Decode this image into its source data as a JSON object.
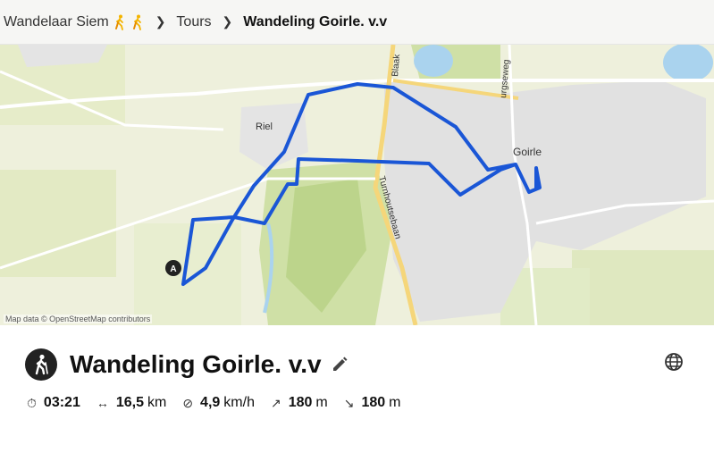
{
  "breadcrumb": {
    "user": "Wandelaar Siem",
    "section": "Tours",
    "current": "Wandeling Goirle. v.v"
  },
  "map": {
    "labels": {
      "riel": "Riel",
      "goirle": "Goirle",
      "blaak": "Blaak",
      "burgseweg": "urgseweg",
      "turnhoutsebaan": "Turnhoutsebaan"
    },
    "start_marker": "A",
    "attribution": "Map data © OpenStreetMap contributors",
    "route_color": "#1a56d6"
  },
  "tour": {
    "title": "Wandeling Goirle. v.v",
    "activity_icon": "hiking-icon",
    "stats": {
      "duration": "03:21",
      "distance_value": "16,5",
      "distance_unit": "km",
      "speed_value": "4,9",
      "speed_unit": "km/h",
      "uphill_value": "180",
      "uphill_unit": "m",
      "downhill_value": "180",
      "downhill_unit": "m"
    }
  }
}
